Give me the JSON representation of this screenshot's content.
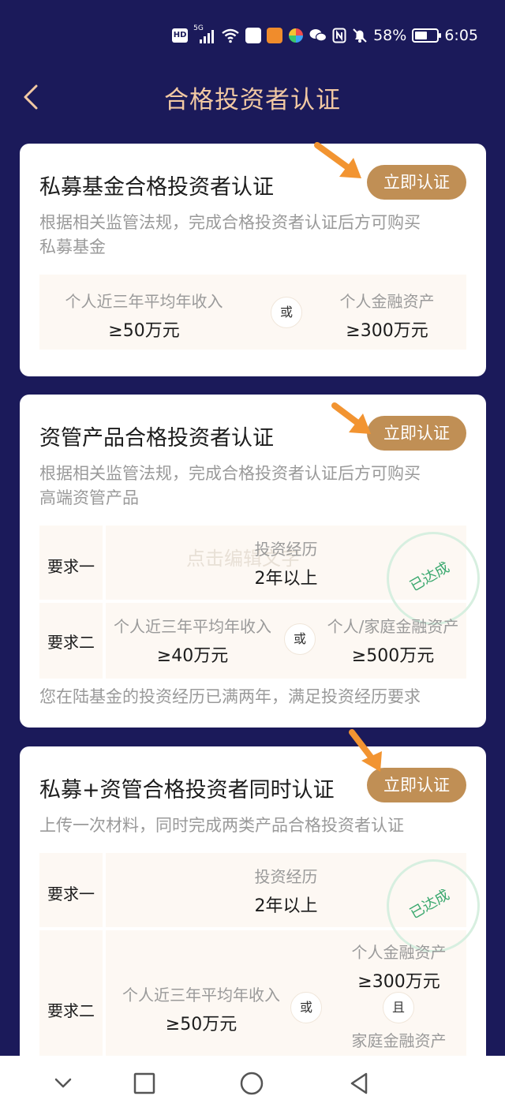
{
  "status_bar": {
    "hd": "HD",
    "signal_label": "5G",
    "battery_pct": "58%",
    "battery_level": 0.58,
    "time": "6:05"
  },
  "header": {
    "title": "合格投资者认证",
    "back_icon": "chevron-left-icon"
  },
  "cards": [
    {
      "title": "私募基金合格投资者认证",
      "cta": "立即认证",
      "desc_lines": [
        "根据相关监管法规，完成合格投资者认证后方可购买",
        "私募基金"
      ],
      "or": "或",
      "left_label": "个人近三年平均年收入",
      "left_value": "≥50万元",
      "right_label": "个人金融资产",
      "right_value": "≥300万元"
    },
    {
      "title": "资管产品合格投资者认证",
      "cta": "立即认证",
      "desc_lines": [
        "根据相关监管法规，完成合格投资者认证后方可购买",
        "高端资管产品"
      ],
      "watermark": "点击编辑文字",
      "req1_label": "要求一",
      "req1_item_label": "投资经历",
      "req1_item_value": "2年以上",
      "stamp": "已达成",
      "req2_label": "要求二",
      "req2_left_label": "个人近三年平均年收入",
      "req2_left_value": "≥40万元",
      "or": "或",
      "req2_right_label": "个人/家庭金融资产",
      "req2_right_value": "≥500万元",
      "note": "您在陆基金的投资经历已满两年，满足投资经历要求"
    },
    {
      "title": "私募+资管合格投资者同时认证",
      "cta": "立即认证",
      "desc": "上传一次材料，同时完成两类产品合格投资者认证",
      "req1_label": "要求一",
      "req1_item_label": "投资经历",
      "req1_item_value": "2年以上",
      "stamp": "已达成",
      "req2_label": "要求二",
      "req2_left_label": "个人近三年平均年收入",
      "req2_left_value": "≥50万元",
      "or": "或",
      "req2_right_label1": "个人金融资产",
      "req2_right_value1": "≥300万元",
      "and": "且",
      "req2_right_label2": "家庭金融资产"
    }
  ],
  "colors": {
    "background": "#1b1a5a",
    "title": "#f2c9a3",
    "cta": "#c08f55",
    "arrow": "#f29431",
    "stamp": "#3aa86e"
  }
}
